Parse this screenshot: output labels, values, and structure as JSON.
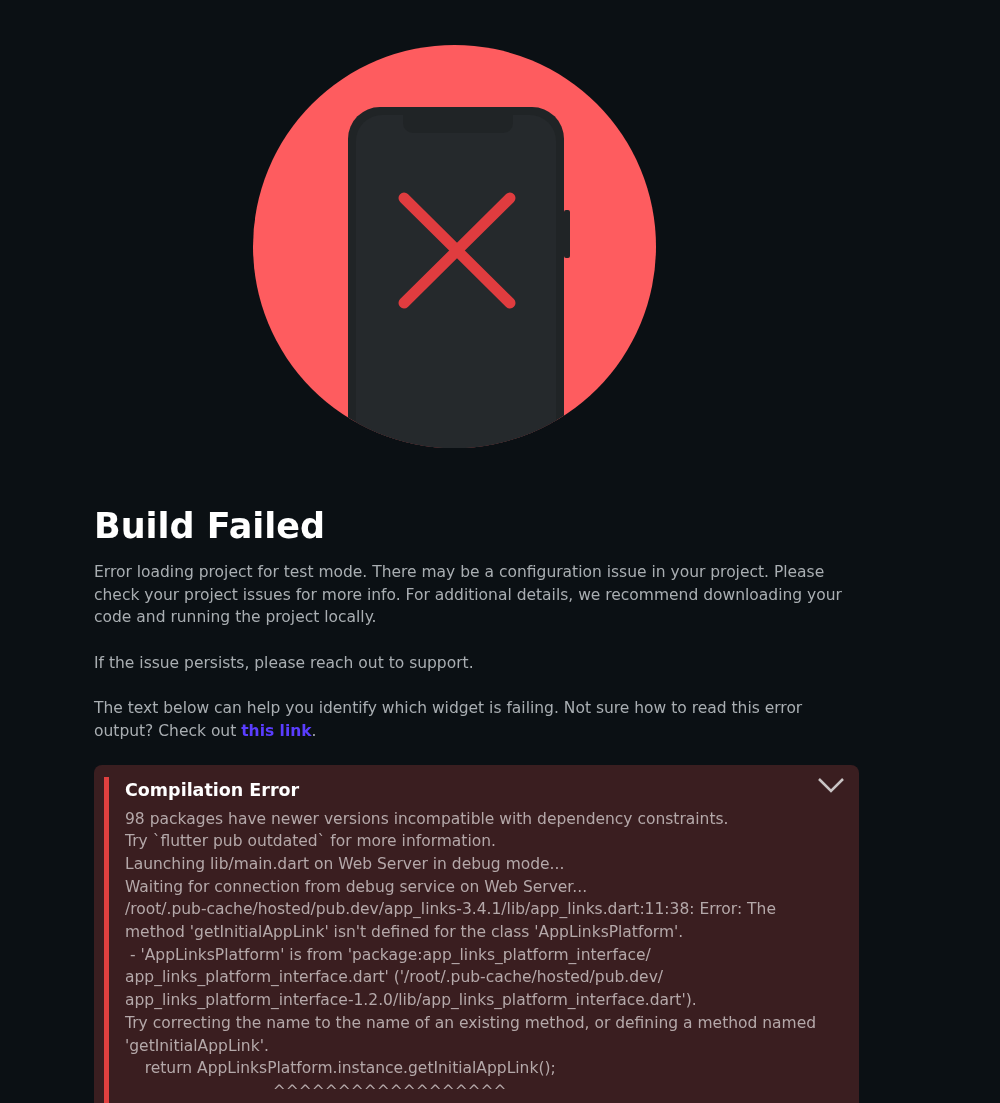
{
  "title": "Build Failed",
  "paragraphs": [
    "Error loading project for test mode. There may be a configuration issue in your project. Please check your project issues for more info. For additional details, we recommend downloading your code and running the project locally.",
    "If the issue persists, please reach out to support."
  ],
  "help": {
    "text": "The text below can help you identify which widget is failing. Not sure how to read this error output? Check out ",
    "link": "this link",
    "end": "."
  },
  "error_panel": {
    "title": "Compilation Error",
    "lines": [
      "98 packages have newer versions incompatible with dependency constraints.",
      "Try `flutter pub outdated` for more information.",
      "Launching lib/main.dart on Web Server in debug mode...",
      "Waiting for connection from debug service on Web Server...",
      "/root/.pub-cache/hosted/pub.dev/app_links-3.4.1/lib/app_links.dart:11:38: Error: The",
      "method 'getInitialAppLink' isn't defined for the class 'AppLinksPlatform'.",
      " - 'AppLinksPlatform' is from 'package:app_links_platform_interface/",
      "app_links_platform_interface.dart' ('/root/.pub-cache/hosted/pub.dev/",
      "app_links_platform_interface-1.2.0/lib/app_links_platform_interface.dart').",
      "Try correcting the name to the name of an existing method, or defining a method named",
      "'getInitialAppLink'.",
      "    return AppLinksPlatform.instance.getInitialAppLink();",
      "                              ^^^^^^^^^^^^^^^^^^"
    ]
  }
}
